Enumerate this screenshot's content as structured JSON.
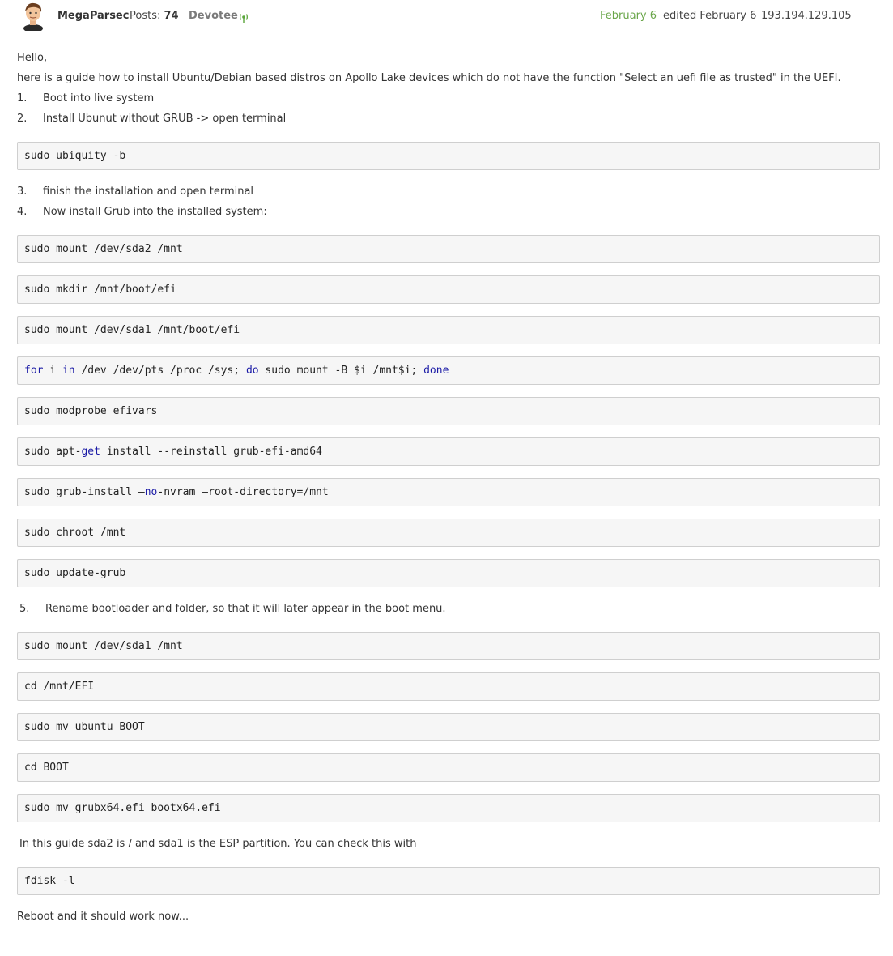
{
  "post": {
    "author": "MegaParsec",
    "posts_label": "Posts:",
    "posts_count": "74",
    "rank": "Devotee",
    "date": "February 6",
    "edited": "edited February 6",
    "ip": "193.194.129.105"
  },
  "content": {
    "greeting": "Hello,",
    "intro": "here is a guide how to install Ubuntu/Debian based distros on Apollo Lake devices which do not have the function \"Select an uefi file as trusted\" in the UEFI.",
    "step1_num": "1.",
    "step1": "Boot into live system",
    "step2_num": "2.",
    "step2": "Install Ubunut without GRUB -> open terminal",
    "code1": "sudo ubiquity -b",
    "step3_num": "3.",
    "step3": "finish the installation and open terminal",
    "step4_num": "4.",
    "step4": "Now install Grub into the installed system:",
    "code2": "sudo mount /dev/sda2 /mnt",
    "code3": "sudo mkdir /mnt/boot/efi",
    "code4": "sudo mount /dev/sda1 /mnt/boot/efi",
    "code5_for": "for",
    "code5_i": " i ",
    "code5_in": "in",
    "code5_mid": " /dev /dev/pts /proc /sys; ",
    "code5_do": "do",
    "code5_cmd": " sudo mount -B $i /mnt$i; ",
    "code5_done": "done",
    "code6": "sudo modprobe efivars",
    "code7_a": "sudo apt-",
    "code7_get": "get",
    "code7_b": " install --reinstall grub-efi-amd64",
    "code8_a": "sudo grub-install –",
    "code8_no": "no",
    "code8_b": "-nvram –root-directory=/mnt",
    "code9": "sudo chroot /mnt",
    "code10": "sudo update-grub",
    "step5_num": "5.",
    "step5": "Rename bootloader and folder, so that it will later appear in the boot menu.",
    "code11": "sudo mount /dev/sda1 /mnt",
    "code12": "cd /mnt/EFI",
    "code13": "sudo mv ubuntu BOOT",
    "code14": "cd BOOT",
    "code15": "sudo mv grubx64.efi bootx64.efi",
    "note": "In this guide sda2 is / and sda1 is the ESP partition. You can check this with",
    "code16": "fdisk -l",
    "outro": "Reboot and it should work now..."
  },
  "icons": {
    "avatar": "user-avatar-icon",
    "rank": "signal-icon"
  },
  "colors": {
    "date": "#6aa64a",
    "keyword": "#1a1aa6"
  }
}
